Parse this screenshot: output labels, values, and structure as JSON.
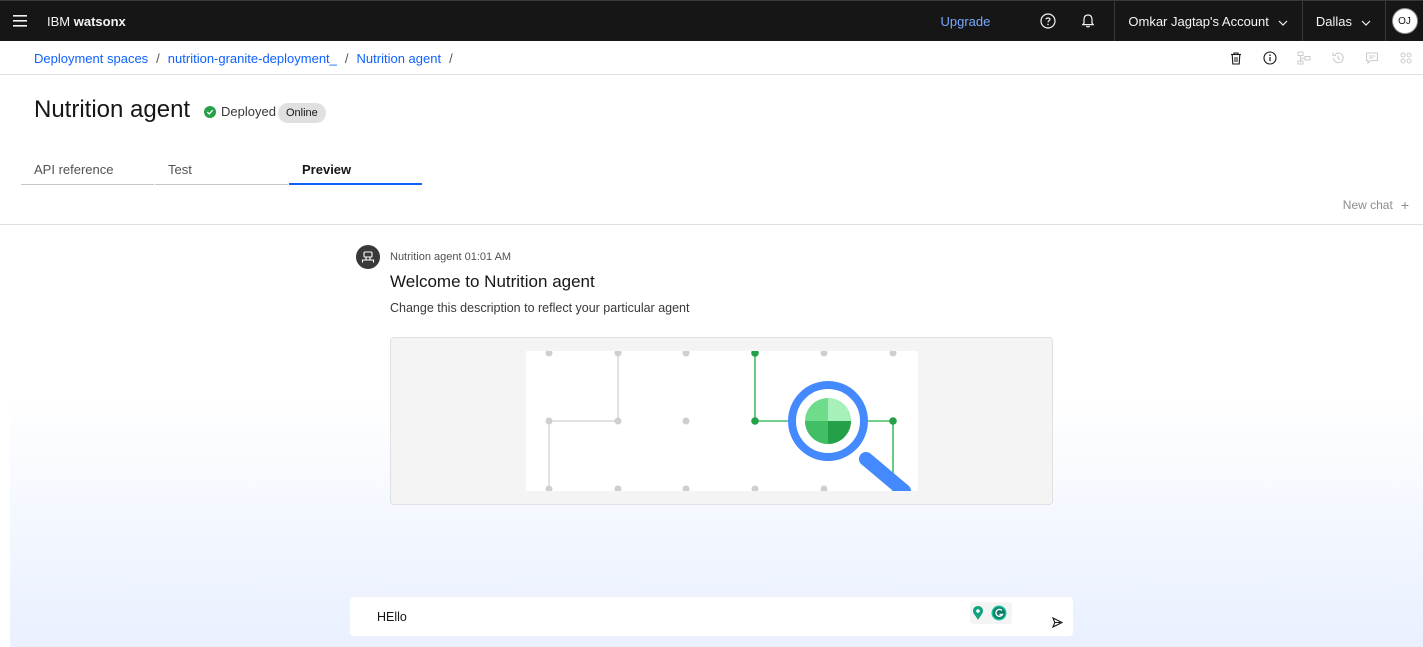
{
  "header": {
    "brand_prefix": "IBM ",
    "brand_name": "watsonx",
    "upgrade_label": "Upgrade",
    "account_label": "Omkar Jagtap's Account",
    "region_label": "Dallas",
    "avatar_initials": "OJ"
  },
  "breadcrumb": {
    "items": [
      "Deployment spaces",
      "nutrition-granite-deployment_",
      "Nutrition agent"
    ],
    "separator": "/"
  },
  "page": {
    "title": "Nutrition agent",
    "status_label": "Deployed",
    "tag_label": "Online"
  },
  "tabs": [
    {
      "label": "API reference",
      "active": false
    },
    {
      "label": "Test",
      "active": false
    },
    {
      "label": "Preview",
      "active": true
    }
  ],
  "chat": {
    "new_chat_label": "New chat",
    "message": {
      "meta": "Nutrition agent 01:01 AM",
      "title": "Welcome to Nutrition agent",
      "description": "Change this description to reflect your particular agent"
    },
    "input_value": "HEllo"
  },
  "icons": {
    "menu": "hamburger-menu-icon",
    "help": "help-icon",
    "notifications": "bell-icon",
    "delete": "trash-icon",
    "info": "info-icon",
    "send": "send-icon"
  },
  "colors": {
    "accent": "#0f62fe",
    "deployed": "#24a148",
    "topbar": "#161616",
    "upgrade": "#78a9ff"
  }
}
